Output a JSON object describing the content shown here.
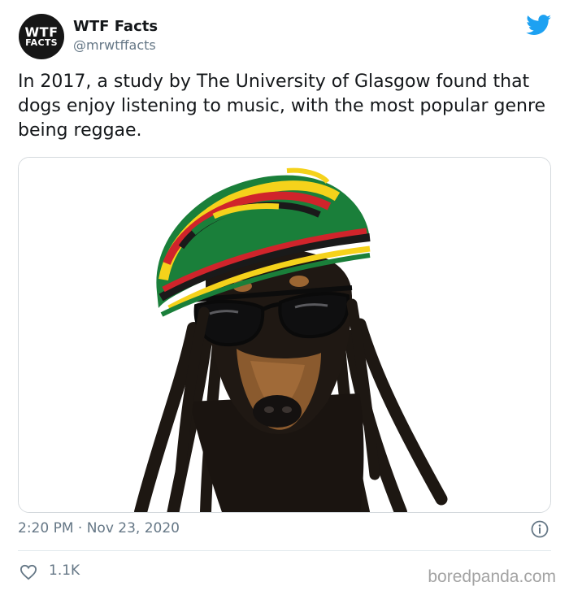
{
  "account": {
    "avatar_line1": "WTF",
    "avatar_line2": "FACTS",
    "name": "WTF Facts",
    "handle": "@mrwtffacts"
  },
  "tweet": {
    "text": "In 2017, a study by The University of Glasgow found that dogs enjoy listening to music, with the most popular genre being reggae.",
    "timestamp": "2:20 PM · Nov 23, 2020",
    "likes": "1.1K"
  },
  "media": {
    "subject": "dog-in-rasta-hat-dreadlocks-sunglasses",
    "hat_stripe_colors": [
      "#1a7f3a",
      "#f5d21b",
      "#d0242b",
      "#1a1a1a"
    ]
  },
  "colors": {
    "twitter_blue": "#1da1f2",
    "secondary_text": "#657786",
    "divider": "#e1e8ed"
  },
  "icons": {
    "platform": "twitter-bird-icon",
    "info": "info-icon",
    "like": "heart-icon"
  },
  "watermark": "boredpanda.com"
}
